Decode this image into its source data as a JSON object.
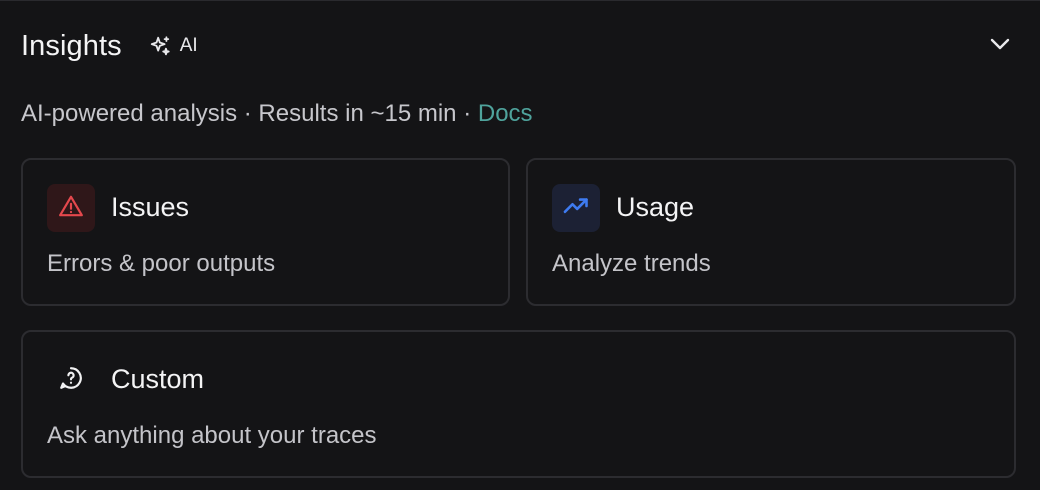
{
  "header": {
    "title": "Insights",
    "badge_label": "AI"
  },
  "subtitle": {
    "text": "AI-powered analysis · Results in ~15 min · ",
    "link": "Docs"
  },
  "cards": [
    {
      "title": "Issues",
      "description": "Errors & poor outputs",
      "icon": "warning-triangle-icon",
      "accent": "#e5484d"
    },
    {
      "title": "Usage",
      "description": "Analyze trends",
      "icon": "trending-up-icon",
      "accent": "#3e7bf0"
    },
    {
      "title": "Custom",
      "description": "Ask anything about your traces",
      "icon": "question-bubble-icon",
      "accent": "#f2f2f3"
    }
  ],
  "colors": {
    "background": "#141416",
    "border": "#2c2c30",
    "link": "#4fa39c"
  }
}
